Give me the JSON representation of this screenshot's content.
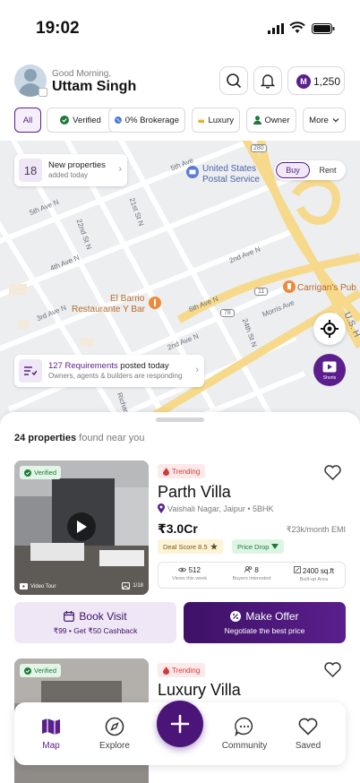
{
  "status_bar": {
    "time": "19:02"
  },
  "header": {
    "greeting": "Good Morning,",
    "user_name": "Uttam Singh",
    "coins": "1,250",
    "coin_letter": "M"
  },
  "filters": [
    {
      "label": "All",
      "active": true
    },
    {
      "label": "Verified",
      "icon": "verified-icon"
    },
    {
      "label": "0% Brokerage",
      "icon": "percent-icon"
    },
    {
      "label": "Luxury",
      "icon": "crown-icon"
    },
    {
      "label": "Owner",
      "icon": "person-icon"
    },
    {
      "label": "More",
      "icon": "chevron-down-icon"
    }
  ],
  "map": {
    "new_properties": {
      "count": "18",
      "title": "New properties",
      "subtitle": "added today"
    },
    "toggle": {
      "buy": "Buy",
      "rent": "Rent",
      "selected": "Buy"
    },
    "labels": {
      "l1": "5th Ave",
      "l2": "5th Ave N",
      "l3": "4th Ave N",
      "l4": "2nd Ave N",
      "l5": "22nd St N",
      "l6": "21st St N",
      "l7": "24th St N",
      "l8": "Morris Ave",
      "l9": "3rd Ave N",
      "l10": "6th Ave N",
      "l11": "2nd Ave N",
      "post_office_1": "United States",
      "post_office_2": "Postal Service",
      "restaurant_1": "El Barrio",
      "restaurant_2": "Restaurante Y Bar",
      "carrigan": "Carrigan's Pub",
      "us_hwy": "U.S. H",
      "shield_280": "280",
      "shield_11": "11",
      "shield_78": "78",
      "richard": "Richard"
    },
    "requirements": {
      "count_text": "127 Requirements",
      "rest_text": " posted today",
      "subtitle": "Owners, agents & builders are responding"
    },
    "shorts_label": "Shorts"
  },
  "sheet": {
    "count": "24 properties",
    "found_suffix": " found near you"
  },
  "listings": [
    {
      "verified": "Verified",
      "video_tour": "Video Tour",
      "photos": "1/18",
      "trend": "Trending",
      "title": "Parth Villa",
      "location": "Vaishali Nagar, Jaipur • 5BHK",
      "price": "₹3.0Cr",
      "emi": "₹23k/month EMI",
      "deal_score": "Deal Score 8.5",
      "price_drop": "Price Drop",
      "stats": [
        {
          "value": "512",
          "label": "Views this week",
          "icon": "eye-icon"
        },
        {
          "value": "8",
          "label": "Buyers interested",
          "icon": "people-icon"
        },
        {
          "value": "2400 sq.ft",
          "label": "Built-up Area",
          "icon": "area-icon"
        }
      ],
      "book_visit": "Book Visit",
      "book_sub": "₹99 • Get ₹50 Cashback",
      "make_offer": "Make Offer",
      "offer_sub": "Negotiate the best price"
    },
    {
      "verified": "Verified",
      "trend": "Trending",
      "title": "Luxury Villa"
    }
  ],
  "nav": {
    "map": "Map",
    "explore": "Explore",
    "community": "Community",
    "saved": "Saved",
    "active": "Map"
  },
  "colors": {
    "brand": "#5a1f8c",
    "brand_dark": "#3e1166",
    "map_bg": "#eceef0",
    "highway": "#f6d98a",
    "trend_red": "#d13a3a",
    "verified_green": "#1e7a3a"
  }
}
